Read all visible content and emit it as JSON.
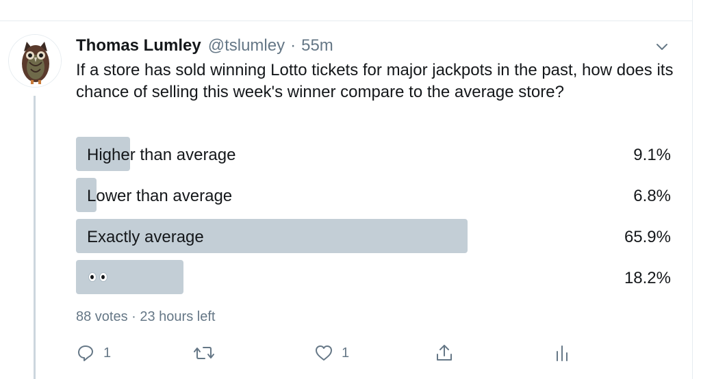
{
  "tweet": {
    "author": {
      "name": "Thomas Lumley",
      "handle": "@tslumley",
      "separator": "·",
      "time": "55m"
    },
    "text": "If a store has sold winning Lotto tickets for major jackpots in the past, how does its chance of selling this week's winner compare to the average store?",
    "poll": {
      "options": [
        {
          "label": "Higher than average",
          "percent_text": "9.1%",
          "percent": 9.1
        },
        {
          "label": "Lower than average",
          "percent_text": "6.8%",
          "percent": 6.8
        },
        {
          "label": "Exactly average",
          "percent_text": "65.9%",
          "percent": 65.9
        },
        {
          "label": "",
          "emoji": "eyes",
          "percent_text": "18.2%",
          "percent": 18.2
        }
      ],
      "meta": "88 votes · 23 hours left"
    },
    "actions": {
      "reply_count": "1",
      "retweet_count": "",
      "like_count": "1"
    }
  },
  "icons": {
    "menu": "chevron-down-icon",
    "reply": "reply-icon",
    "retweet": "retweet-icon",
    "like": "heart-icon",
    "share": "share-icon",
    "analytics": "analytics-icon"
  },
  "colors": {
    "bar": "#c3ced6",
    "secondary_text": "#657786",
    "primary_text": "#14171a",
    "divider": "#e6ecf0"
  }
}
